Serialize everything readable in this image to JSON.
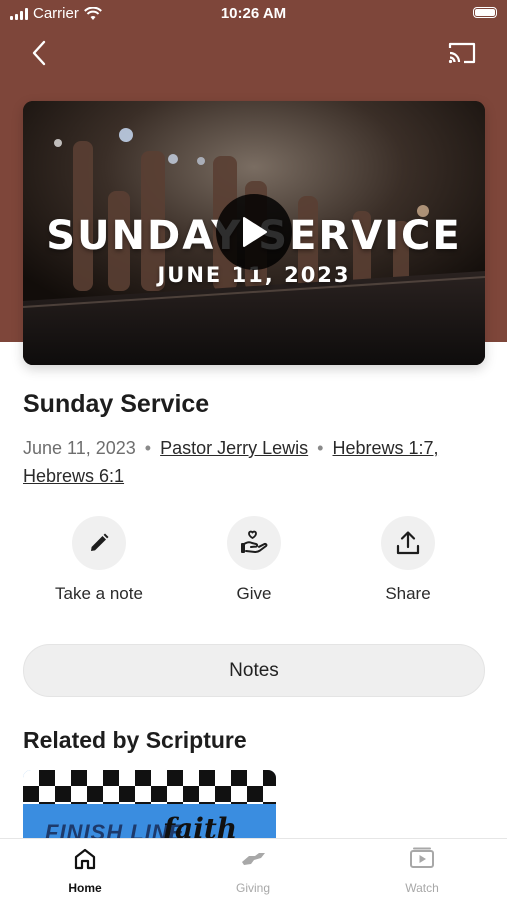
{
  "status_bar": {
    "carrier": "Carrier",
    "time": "10:26 AM"
  },
  "video": {
    "thumbnail_title": "SUNDAY SERVICE",
    "thumbnail_date": "JUNE 11, 2023"
  },
  "sermon": {
    "title": "Sunday Service",
    "date": "June 11, 2023",
    "separator": "•",
    "speaker": "Pastor Jerry Lewis",
    "scripture": "Hebrews 1:7, Hebrews 6:1"
  },
  "actions": {
    "note": "Take a note",
    "give": "Give",
    "share": "Share"
  },
  "notes_button": "Notes",
  "related": {
    "heading": "Related by Scripture",
    "card_text": "FINISH LINE",
    "card_script": "faith"
  },
  "tabs": {
    "home": "Home",
    "giving": "Giving",
    "watch": "Watch"
  },
  "colors": {
    "hero_background": "#7e463a",
    "tab_active": "#111111",
    "tab_inactive": "#a8a8a8"
  },
  "icons": {
    "back": "chevron-left-icon",
    "cast": "cast-icon",
    "play": "play-icon",
    "note": "pencil-icon",
    "give": "heart-hand-icon",
    "share": "share-upload-icon",
    "home": "home-icon",
    "giving": "handshake-icon",
    "watch": "video-play-icon"
  }
}
